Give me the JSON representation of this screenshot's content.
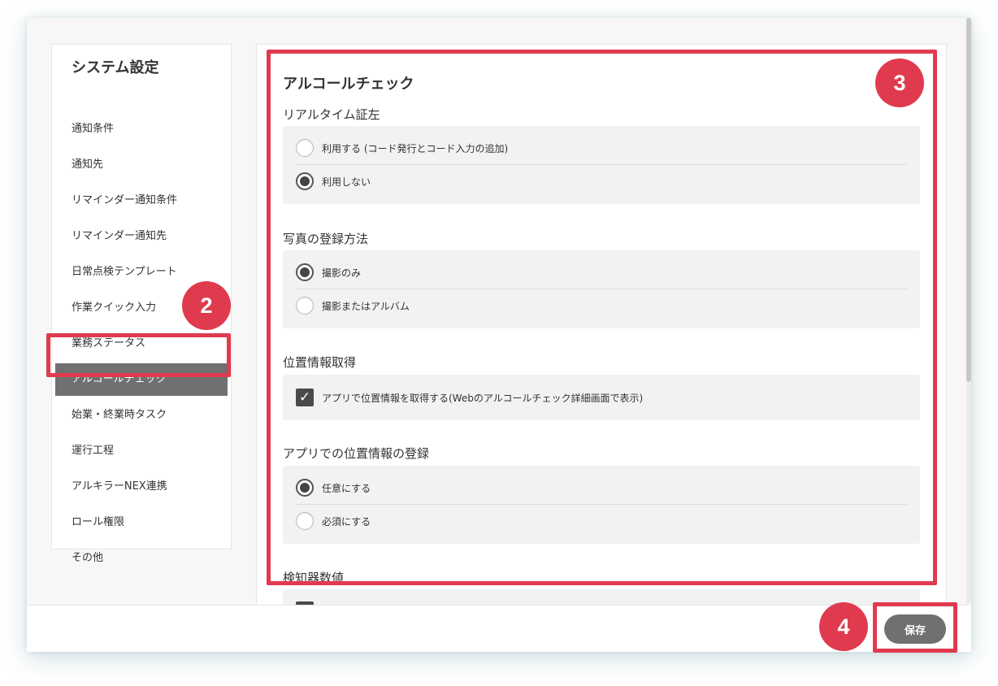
{
  "sidebar": {
    "title": "システム設定",
    "items": [
      {
        "label": "通知条件"
      },
      {
        "label": "通知先"
      },
      {
        "label": "リマインダー通知条件"
      },
      {
        "label": "リマインダー通知先"
      },
      {
        "label": "日常点検テンプレート"
      },
      {
        "label": "作業クイック入力"
      },
      {
        "label": "業務ステータス"
      },
      {
        "label": "アルコールチェック",
        "active": true
      },
      {
        "label": "始業・終業時タスク"
      },
      {
        "label": "運行工程"
      },
      {
        "label": "アルキラーNEX連携"
      },
      {
        "label": "ロール権限"
      },
      {
        "label": "その他"
      }
    ]
  },
  "main": {
    "title": "アルコールチェック",
    "sections": [
      {
        "label": "リアルタイム証左",
        "options": [
          {
            "label": "利用する (コード発行とコード入力の追加)",
            "selected": false
          },
          {
            "label": "利用しない",
            "selected": true
          }
        ]
      },
      {
        "label": "写真の登録方法",
        "options": [
          {
            "label": "撮影のみ",
            "selected": true
          },
          {
            "label": "撮影またはアルバム",
            "selected": false
          }
        ]
      },
      {
        "label": "位置情報取得",
        "checkbox": {
          "label": "アプリで位置情報を取得する(Webのアルコールチェック詳細画面で表示)",
          "checked": true
        }
      },
      {
        "label": "アプリでの位置情報の登録",
        "options": [
          {
            "label": "任意にする",
            "selected": true
          },
          {
            "label": "必須にする",
            "selected": false
          }
        ]
      },
      {
        "label": "検知器数値"
      }
    ]
  },
  "footer": {
    "save_label": "保存"
  },
  "annotations": {
    "badge_2": "2",
    "badge_3": "3",
    "badge_4": "4",
    "highlight_color": "#e03a4e"
  },
  "icons": {
    "check": "check-icon",
    "radio": "radio-icon"
  }
}
